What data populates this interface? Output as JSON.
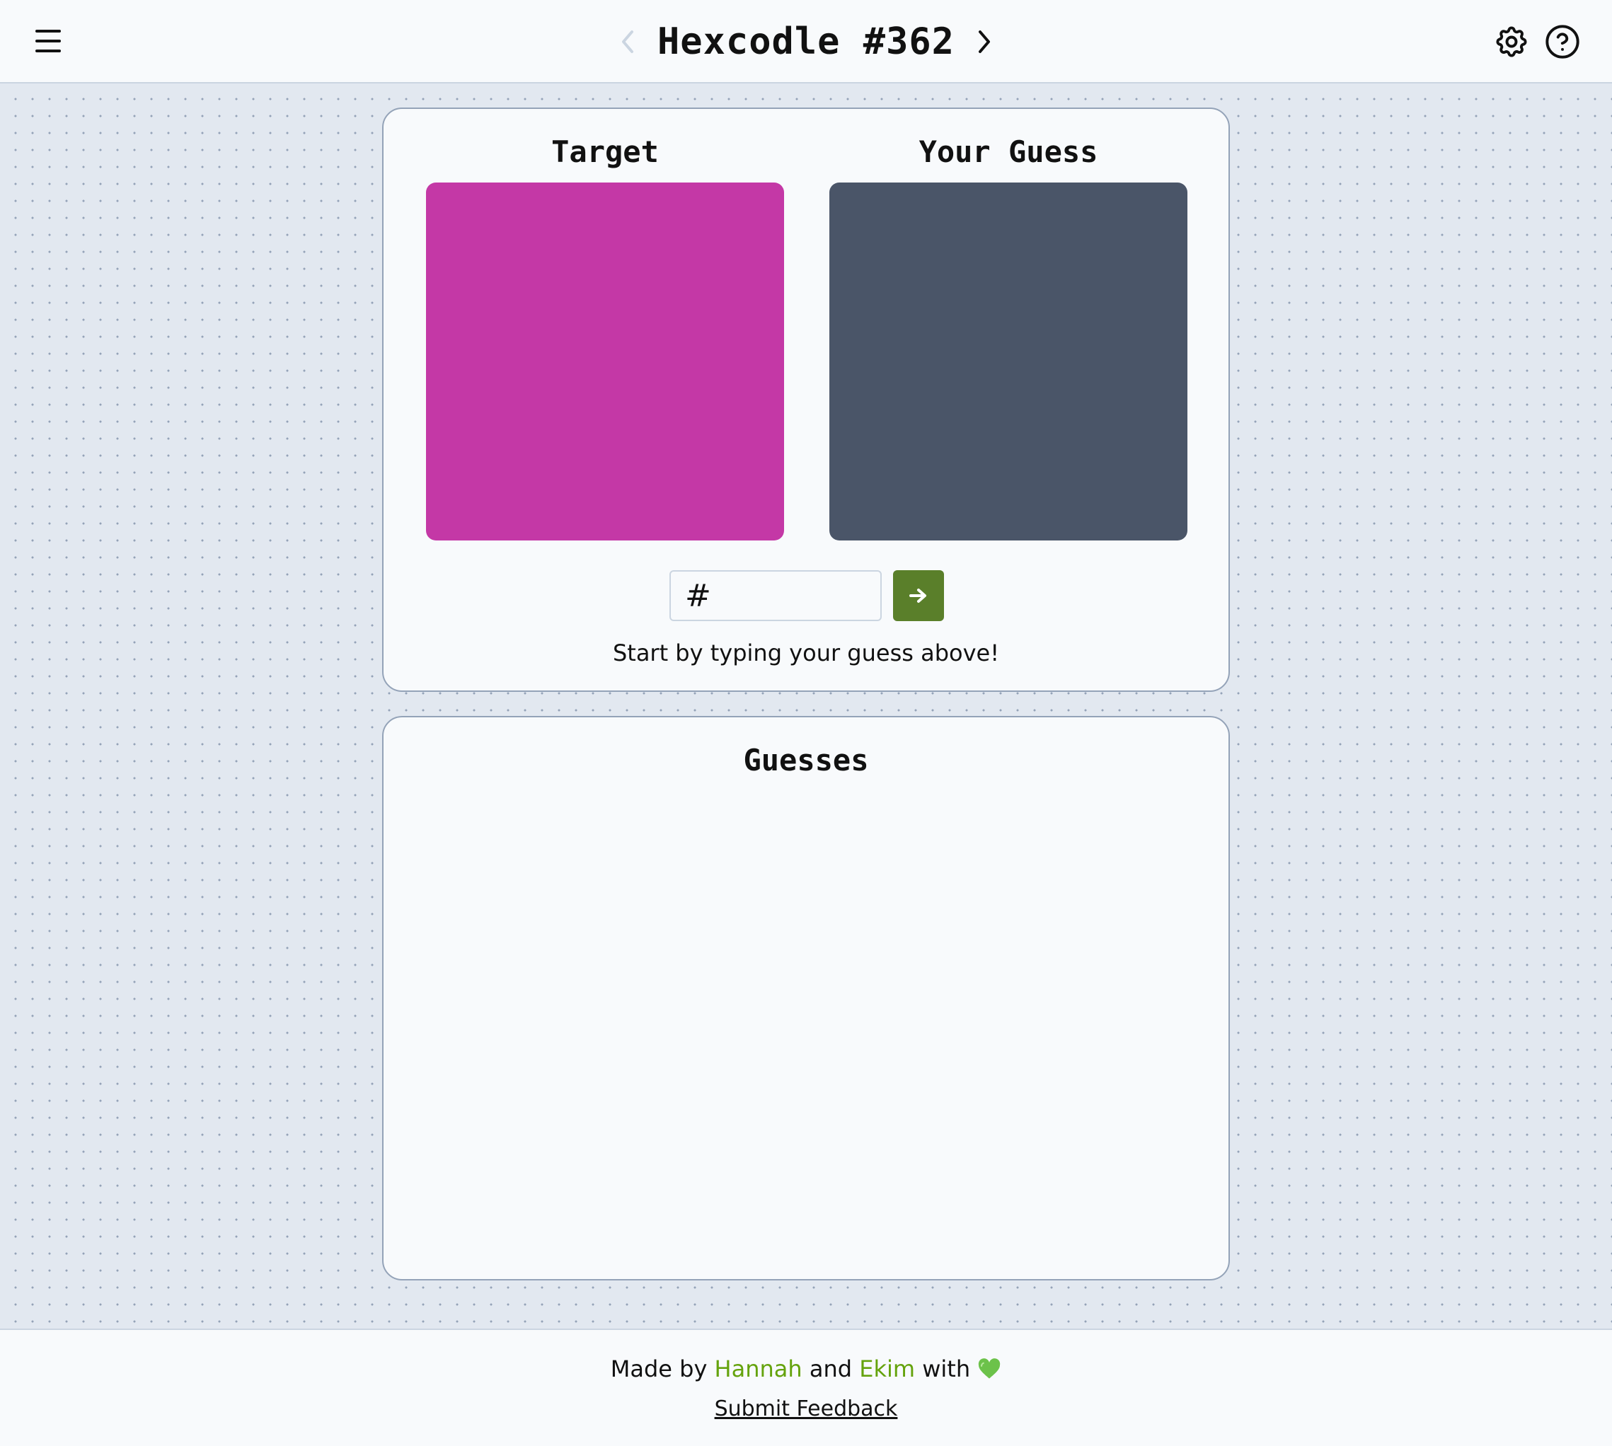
{
  "header": {
    "title": "Hexcodle #362",
    "menu_icon": "hamburger-icon",
    "prev_icon": "chevron-left-icon",
    "next_icon": "chevron-right-icon",
    "settings_icon": "gear-icon",
    "help_icon": "help-circle-icon"
  },
  "game": {
    "target_label": "Target",
    "guess_label": "Your Guess",
    "target_color": "#c438a6",
    "guess_color": "#4a5568",
    "input_value": "#",
    "submit_icon": "arrow-right-icon",
    "submit_color": "#5a7f2a",
    "hint": "Start by typing your guess above!"
  },
  "guesses": {
    "title": "Guesses",
    "items": []
  },
  "footer": {
    "made_by": "Made by",
    "author1": "Hannah",
    "and": "and",
    "author2": "Ekim",
    "with": "with",
    "heart_icon": "green-heart-icon",
    "feedback": "Submit Feedback"
  }
}
